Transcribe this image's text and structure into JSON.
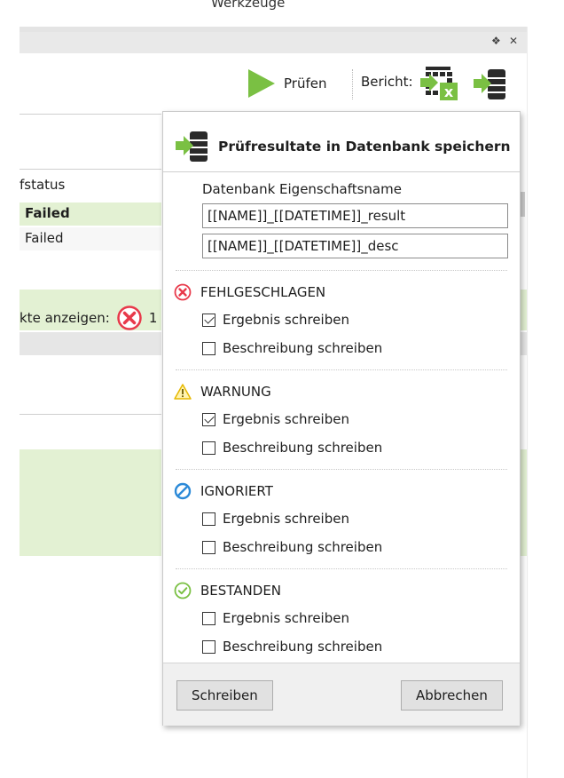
{
  "window": {
    "title": "Werkzeuge"
  },
  "panel": {
    "pin_icon": "pin-icon",
    "close_icon": "close-icon",
    "pin_glyph": "❖",
    "close_glyph": "✕"
  },
  "toolbar": {
    "pruefen_label": "Prüfen",
    "bericht_label": "Bericht:",
    "icons": [
      "play-icon",
      "excel-report-icon",
      "database-export-icon"
    ]
  },
  "background": {
    "column_header": "fstatus",
    "rows": [
      "Failed",
      "Failed"
    ],
    "show_objects_text": "kte anzeigen:",
    "trailing": "1"
  },
  "popup": {
    "title": "Prüfresultate in Datenbank speichern",
    "field_label": "Datenbank Eigenschaftsname",
    "result_value": "[[NAME]]_[[DATETIME]]_result",
    "desc_value": "[[NAME]]_[[DATETIME]]_desc",
    "sections": [
      {
        "title": "FEHLGESCHLAGEN",
        "icon": "failed-icon",
        "color": "#e8394a",
        "result_label": "Ergebnis schreiben",
        "result_checked": true,
        "desc_label": "Beschreibung schreiben",
        "desc_checked": false
      },
      {
        "title": "WARNUNG",
        "icon": "warning-icon",
        "color": "#f2c811",
        "result_label": "Ergebnis schreiben",
        "result_checked": true,
        "desc_label": "Beschreibung schreiben",
        "desc_checked": false
      },
      {
        "title": "IGNORIERT",
        "icon": "ignored-icon",
        "color": "#2c8ad8",
        "result_label": "Ergebnis schreiben",
        "result_checked": false,
        "desc_label": "Beschreibung schreiben",
        "desc_checked": false
      },
      {
        "title": "BESTANDEN",
        "icon": "passed-icon",
        "color": "#7ac043",
        "result_label": "Ergebnis schreiben",
        "result_checked": false,
        "desc_label": "Beschreibung schreiben",
        "desc_checked": false
      }
    ],
    "write_button": "Schreiben",
    "cancel_button": "Abbrechen"
  },
  "colors": {
    "accent_green": "#7ac043",
    "row_highlight": "#e3f1d3"
  }
}
